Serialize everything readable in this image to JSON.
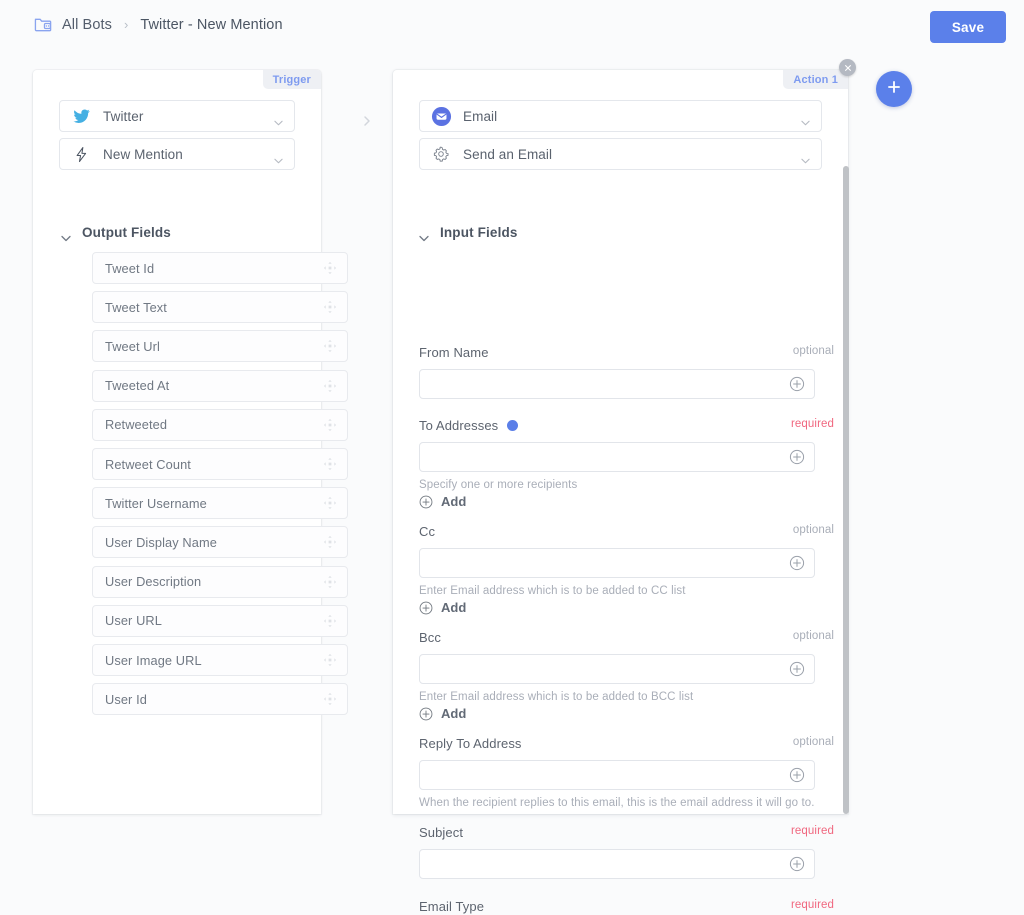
{
  "header": {
    "breadcrumb_icon": "folder-bot-icon",
    "breadcrumb_root": "All Bots",
    "breadcrumb_separator": "›",
    "breadcrumb_current": "Twitter - New Mention",
    "save_label": "Save",
    "accent_color": "#5b80ea"
  },
  "trigger_card": {
    "tab_label": "Trigger",
    "app_select": {
      "icon": "twitter-icon",
      "value": "Twitter"
    },
    "event_select": {
      "icon": "lightning-bolt-icon",
      "value": "New Mention"
    },
    "section_title": "Output Fields",
    "output_fields": [
      "Tweet Id",
      "Tweet Text",
      "Tweet Url",
      "Tweeted At",
      "Retweeted",
      "Retweet Count",
      "Twitter Username",
      "User Display Name",
      "User Description",
      "User URL",
      "User Image URL",
      "User Id"
    ]
  },
  "action_card": {
    "tab_label": "Action 1",
    "close_icon": "close-icon",
    "app_select": {
      "icon": "email-icon",
      "value": "Email"
    },
    "operation_select": {
      "icon": "gear-icon",
      "value": "Send an Email"
    },
    "section_title": "Input Fields",
    "add_label": "Add",
    "fields": [
      {
        "label": "From Name",
        "requirement": "optional",
        "value": "",
        "has_dot": false,
        "help": "",
        "has_add": false
      },
      {
        "label": "To Addresses",
        "requirement": "required",
        "value": "",
        "has_dot": true,
        "help": "Specify one or more recipients",
        "has_add": true
      },
      {
        "label": "Cc",
        "requirement": "optional",
        "value": "",
        "has_dot": false,
        "help": "Enter Email address which is to be added to CC list",
        "has_add": true
      },
      {
        "label": "Bcc",
        "requirement": "optional",
        "value": "",
        "has_dot": false,
        "help": "Enter Email address which is to be added to BCC list",
        "has_add": true
      },
      {
        "label": "Reply To Address",
        "requirement": "optional",
        "value": "",
        "has_dot": false,
        "help": "When the recipient replies to this email, this is the email address it will go to.",
        "has_add": false
      },
      {
        "label": "Subject",
        "requirement": "required",
        "value": "",
        "has_dot": false,
        "help": "",
        "has_add": false
      },
      {
        "label": "Email Type",
        "requirement": "required",
        "value": "",
        "has_dot": false,
        "help": "",
        "has_add": false
      }
    ]
  },
  "canvas": {
    "connector_icon": "chevron-right-icon",
    "add_step_icon": "plus-icon"
  }
}
